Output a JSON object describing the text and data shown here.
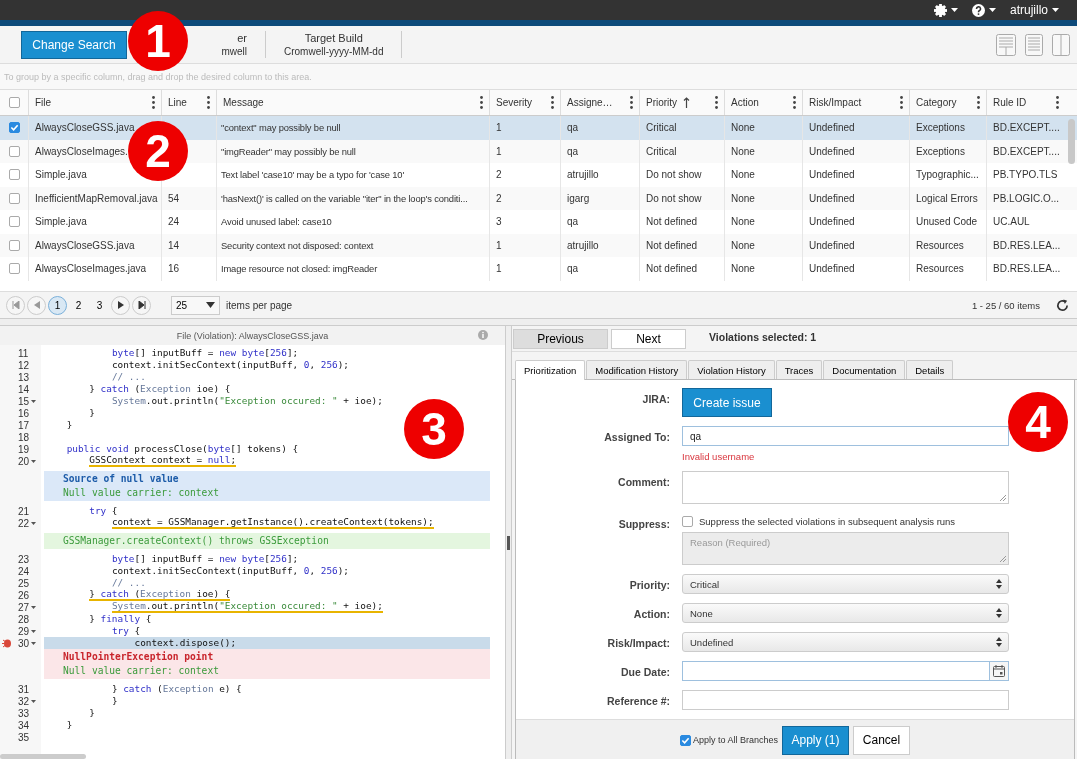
{
  "topbar": {
    "user": "atrujillo"
  },
  "toolbar": {
    "change_search": "Change Search",
    "builds": [
      {
        "title": "er",
        "value": "mwell"
      },
      {
        "title": "Target Build",
        "value": "Cromwell-yyyy-MM-dd"
      }
    ]
  },
  "group_hint": "To group by a specific column, drag and drop the desired column to this area.",
  "table": {
    "select_all_checked": false,
    "columns": [
      {
        "label": "File",
        "sorted": false
      },
      {
        "label": "Line",
        "sorted": false
      },
      {
        "label": "Message",
        "sorted": false
      },
      {
        "label": "Severity",
        "sorted": false
      },
      {
        "label": "Assigne…",
        "sorted": false
      },
      {
        "label": "Priority",
        "sorted": true
      },
      {
        "label": "Action",
        "sorted": false
      },
      {
        "label": "Risk/Impact",
        "sorted": false
      },
      {
        "label": "Category",
        "sorted": false
      },
      {
        "label": "Rule ID",
        "sorted": false
      }
    ],
    "rows": [
      {
        "selected": true,
        "cells": [
          "AlwaysCloseGSS.java",
          null,
          "\"context\" may possibly be null",
          "1",
          "qa",
          "Critical",
          "None",
          "Undefined",
          "Exceptions",
          "BD.EXCEPT...."
        ]
      },
      {
        "selected": false,
        "cells": [
          "AlwaysCloseImages.",
          null,
          "\"imgReader\" may possibly be null",
          "1",
          "qa",
          "Critical",
          "None",
          "Undefined",
          "Exceptions",
          "BD.EXCEPT...."
        ]
      },
      {
        "selected": false,
        "cells": [
          "Simple.java",
          null,
          "Text label 'case10' may be a typo for 'case 10'",
          "2",
          "atrujillo",
          "Do not show",
          "None",
          "Undefined",
          "Typographic...",
          "PB.TYPO.TLS"
        ]
      },
      {
        "selected": false,
        "cells": [
          "InefficientMapRemoval.java",
          "54",
          "'hasNext()' is called on the variable \"iter\" in the loop's conditi...",
          "2",
          "igarg",
          "Do not show",
          "None",
          "Undefined",
          "Logical Errors",
          "PB.LOGIC.O..."
        ]
      },
      {
        "selected": false,
        "cells": [
          "Simple.java",
          "24",
          "Avoid unused label: case10",
          "3",
          "qa",
          "Not defined",
          "None",
          "Undefined",
          "Unused Code",
          "UC.AUL"
        ]
      },
      {
        "selected": false,
        "cells": [
          "AlwaysCloseGSS.java",
          "14",
          "Security context not disposed: context",
          "1",
          "atrujillo",
          "Not defined",
          "None",
          "Undefined",
          "Resources",
          "BD.RES.LEA..."
        ]
      },
      {
        "selected": false,
        "cells": [
          "AlwaysCloseImages.java",
          "16",
          "Image resource not closed: imgReader",
          "1",
          "qa",
          "Not defined",
          "None",
          "Undefined",
          "Resources",
          "BD.RES.LEA..."
        ]
      }
    ]
  },
  "pager": {
    "pages": [
      {
        "label": "1",
        "selected": true
      },
      {
        "label": "2",
        "selected": false
      },
      {
        "label": "3",
        "selected": false
      }
    ],
    "page_size": "25",
    "page_size_label": "items per page",
    "summary": "1 - 25 / 60 items"
  },
  "code_view": {
    "title": "File (Violation): AlwaysCloseGSS.java",
    "items": [
      {
        "kind": "block",
        "children": [
          {
            "kind": "block",
            "children": [
              {
                "kind": "block",
                "children": [
                  {
                    "kind": "line",
                    "number": "11",
                    "fold": false,
                    "underline": false,
                    "highlight": false,
                    "flag": false,
                    "segments": [
                      {
                        "kind": "kw",
                        "text": "byte"
                      },
                      {
                        "kind": "plain",
                        "text": "[] inputBuff = "
                      },
                      {
                        "kind": "kw",
                        "text": "new byte"
                      },
                      {
                        "kind": "plain",
                        "text": "["
                      },
                      {
                        "kind": "num",
                        "text": "256"
                      },
                      {
                        "kind": "plain",
                        "text": "];"
                      }
                    ]
                  },
                  {
                    "kind": "line",
                    "number": "12",
                    "fold": false,
                    "underline": false,
                    "highlight": false,
                    "flag": false,
                    "segments": [
                      {
                        "kind": "plain",
                        "text": "context.initSecContext(inputBuff, "
                      },
                      {
                        "kind": "num",
                        "text": "0"
                      },
                      {
                        "kind": "plain",
                        "text": ", "
                      },
                      {
                        "kind": "num",
                        "text": "256"
                      },
                      {
                        "kind": "plain",
                        "text": ");"
                      }
                    ]
                  },
                  {
                    "kind": "line",
                    "number": "13",
                    "fold": false,
                    "underline": false,
                    "highlight": false,
                    "flag": false,
                    "segments": [
                      {
                        "kind": "comment",
                        "text": "// ..."
                      }
                    ]
                  }
                ]
              },
              {
                "kind": "line",
                "number": "14",
                "fold": false,
                "underline": false,
                "highlight": false,
                "flag": false,
                "segments": [
                  {
                    "kind": "plain",
                    "text": "} "
                  },
                  {
                    "kind": "kw",
                    "text": "catch"
                  },
                  {
                    "kind": "plain",
                    "text": " ("
                  },
                  {
                    "kind": "type",
                    "text": "Exception"
                  },
                  {
                    "kind": "plain",
                    "text": " ioe) {"
                  }
                ]
              },
              {
                "kind": "block",
                "children": [
                  {
                    "kind": "line",
                    "number": "15",
                    "fold": true,
                    "underline": false,
                    "highlight": false,
                    "flag": false,
                    "segments": [
                      {
                        "kind": "type",
                        "text": "System"
                      },
                      {
                        "kind": "plain",
                        "text": ".out.println("
                      },
                      {
                        "kind": "str",
                        "text": "\"Exception occured: \""
                      },
                      {
                        "kind": "plain",
                        "text": " + ioe);"
                      }
                    ]
                  }
                ]
              },
              {
                "kind": "line",
                "number": "16",
                "fold": false,
                "underline": false,
                "highlight": false,
                "flag": false,
                "segments": [
                  {
                    "kind": "plain",
                    "text": "}"
                  }
                ]
              }
            ]
          },
          {
            "kind": "line",
            "number": "17",
            "fold": false,
            "underline": false,
            "highlight": false,
            "flag": false,
            "segments": [
              {
                "kind": "plain",
                "text": "}"
              }
            ]
          },
          {
            "kind": "line",
            "number": "18",
            "fold": false,
            "highlight": false,
            "flag": false
          },
          {
            "kind": "line",
            "number": "19",
            "fold": false,
            "underline": false,
            "highlight": false,
            "flag": false,
            "segments": [
              {
                "kind": "kw",
                "text": "public void"
              },
              {
                "kind": "plain",
                "text": " processClose("
              },
              {
                "kind": "kw",
                "text": "byte"
              },
              {
                "kind": "plain",
                "text": "[] tokens) {"
              }
            ]
          },
          {
            "kind": "block",
            "children": [
              {
                "kind": "line",
                "number": "20",
                "fold": true,
                "underline": true,
                "highlight": false,
                "flag": false,
                "segments": [
                  {
                    "kind": "plain",
                    "text": "GSSContext context = "
                  },
                  {
                    "kind": "kw",
                    "text": "null"
                  },
                  {
                    "kind": "plain",
                    "text": ";"
                  }
                ]
              },
              {
                "kind": "source",
                "lines": [
                  {
                    "kind": "title",
                    "text": "Source of null value"
                  },
                  {
                    "kind": "detail",
                    "text": "Null value carrier: context"
                  }
                ]
              },
              {
                "kind": "line",
                "number": "21",
                "fold": false,
                "underline": false,
                "highlight": false,
                "flag": false,
                "segments": [
                  {
                    "kind": "kw",
                    "text": "try"
                  },
                  {
                    "kind": "plain",
                    "text": " {"
                  }
                ]
              },
              {
                "kind": "block",
                "children": [
                  {
                    "kind": "line",
                    "number": "22",
                    "fold": true,
                    "underline": true,
                    "highlight": false,
                    "flag": false,
                    "segments": [
                      {
                        "kind": "plain",
                        "text": "context = GSSManager.getInstance().createContext(tokens);"
                      }
                    ]
                  },
                  {
                    "kind": "throws",
                    "lines": [
                      {
                        "kind": "detail",
                        "text": "GSSManager.createContext() throws GSSException"
                      }
                    ]
                  },
                  {
                    "kind": "line",
                    "number": "23",
                    "fold": false,
                    "underline": false,
                    "highlight": false,
                    "flag": false,
                    "segments": [
                      {
                        "kind": "kw",
                        "text": "byte"
                      },
                      {
                        "kind": "plain",
                        "text": "[] inputBuff = "
                      },
                      {
                        "kind": "kw",
                        "text": "new byte"
                      },
                      {
                        "kind": "plain",
                        "text": "["
                      },
                      {
                        "kind": "num",
                        "text": "256"
                      },
                      {
                        "kind": "plain",
                        "text": "];"
                      }
                    ]
                  },
                  {
                    "kind": "line",
                    "number": "24",
                    "fold": false,
                    "underline": false,
                    "highlight": false,
                    "flag": false,
                    "segments": [
                      {
                        "kind": "plain",
                        "text": "context.initSecContext(inputBuff, "
                      },
                      {
                        "kind": "num",
                        "text": "0"
                      },
                      {
                        "kind": "plain",
                        "text": ", "
                      },
                      {
                        "kind": "num",
                        "text": "256"
                      },
                      {
                        "kind": "plain",
                        "text": ");"
                      }
                    ]
                  },
                  {
                    "kind": "line",
                    "number": "25",
                    "fold": false,
                    "underline": false,
                    "highlight": false,
                    "flag": false,
                    "segments": [
                      {
                        "kind": "comment",
                        "text": "// ..."
                      }
                    ]
                  }
                ]
              },
              {
                "kind": "line",
                "number": "26",
                "fold": false,
                "underline": true,
                "highlight": false,
                "flag": false,
                "segments": [
                  {
                    "kind": "plain",
                    "text": "} "
                  },
                  {
                    "kind": "kw",
                    "text": "catch"
                  },
                  {
                    "kind": "plain",
                    "text": " ("
                  },
                  {
                    "kind": "type",
                    "text": "Exception"
                  },
                  {
                    "kind": "plain",
                    "text": " ioe) {"
                  }
                ]
              },
              {
                "kind": "block",
                "children": [
                  {
                    "kind": "line",
                    "number": "27",
                    "fold": true,
                    "underline": true,
                    "highlight": false,
                    "flag": false,
                    "segments": [
                      {
                        "kind": "type",
                        "text": "System"
                      },
                      {
                        "kind": "plain",
                        "text": ".out.println("
                      },
                      {
                        "kind": "str",
                        "text": "\"Exception occured: \""
                      },
                      {
                        "kind": "plain",
                        "text": " + ioe);"
                      }
                    ]
                  }
                ]
              },
              {
                "kind": "line",
                "number": "28",
                "fold": false,
                "underline": false,
                "highlight": false,
                "flag": false,
                "segments": [
                  {
                    "kind": "plain",
                    "text": "} "
                  },
                  {
                    "kind": "kw",
                    "text": "finally"
                  },
                  {
                    "kind": "plain",
                    "text": " {"
                  }
                ]
              },
              {
                "kind": "block",
                "children": [
                  {
                    "kind": "line",
                    "number": "29",
                    "fold": true,
                    "underline": false,
                    "highlight": false,
                    "flag": false,
                    "segments": [
                      {
                        "kind": "kw",
                        "text": "try"
                      },
                      {
                        "kind": "plain",
                        "text": " {"
                      }
                    ]
                  },
                  {
                    "kind": "block",
                    "children": [
                      {
                        "kind": "line",
                        "number": "30",
                        "fold": true,
                        "underline": false,
                        "highlight": true,
                        "flag": true,
                        "segments": [
                          {
                            "kind": "plain",
                            "text": "context.dispose();"
                          }
                        ]
                      },
                      {
                        "kind": "crash",
                        "lines": [
                          {
                            "kind": "title",
                            "text": "NullPointerException point"
                          },
                          {
                            "kind": "detail",
                            "text": "Null value carrier: context"
                          }
                        ]
                      }
                    ]
                  },
                  {
                    "kind": "line",
                    "number": "31",
                    "fold": false,
                    "underline": false,
                    "highlight": false,
                    "flag": false,
                    "segments": [
                      {
                        "kind": "plain",
                        "text": "} "
                      },
                      {
                        "kind": "kw",
                        "text": "catch"
                      },
                      {
                        "kind": "plain",
                        "text": " ("
                      },
                      {
                        "kind": "type",
                        "text": "Exception"
                      },
                      {
                        "kind": "plain",
                        "text": " e) {"
                      }
                    ]
                  },
                  {
                    "kind": "line",
                    "number": "32",
                    "fold": true,
                    "underline": false,
                    "highlight": false,
                    "flag": false,
                    "segments": [
                      {
                        "kind": "plain",
                        "text": "}"
                      }
                    ]
                  }
                ]
              },
              {
                "kind": "line",
                "number": "33",
                "fold": false,
                "underline": false,
                "highlight": false,
                "flag": false,
                "segments": [
                  {
                    "kind": "plain",
                    "text": "}"
                  }
                ]
              }
            ]
          },
          {
            "kind": "line",
            "number": "34",
            "fold": false,
            "underline": false,
            "highlight": false,
            "flag": false,
            "segments": [
              {
                "kind": "plain",
                "text": "}"
              }
            ]
          },
          {
            "kind": "line",
            "number": "35",
            "fold": false,
            "highlight": false,
            "flag": false
          }
        ]
      }
    ]
  },
  "details": {
    "nav": [
      {
        "label": "Previous",
        "selected": true
      },
      {
        "label": "Next",
        "selected": false
      }
    ],
    "selection_count": "Violations selected: 1",
    "tabs": [
      {
        "label": "Prioritization",
        "selected": true
      },
      {
        "label": "Modification History",
        "selected": false
      },
      {
        "label": "Violation History",
        "selected": false
      },
      {
        "label": "Traces",
        "selected": false
      },
      {
        "label": "Documentation",
        "selected": false
      },
      {
        "label": "Details",
        "selected": false
      }
    ],
    "fields": [
      {
        "kind": "button",
        "label": "JIRA:",
        "button": "Create issue"
      },
      {
        "kind": "text",
        "label": "Assigned To:",
        "value": "qa",
        "error": "Invalid username"
      },
      {
        "kind": "textarea",
        "label": "Comment:"
      },
      {
        "kind": "suppress",
        "label": "Suppress:",
        "checked": false,
        "option": "Suppress the selected violations in subsequent analysis runs",
        "placeholder": "Reason (Required)"
      },
      {
        "kind": "select",
        "label": "Priority:",
        "value": "Critical"
      },
      {
        "kind": "select",
        "label": "Action:",
        "value": "None"
      },
      {
        "kind": "select",
        "label": "Risk/Impact:",
        "value": "Undefined"
      },
      {
        "kind": "date",
        "label": "Due Date:"
      },
      {
        "kind": "text",
        "label": "Reference #:"
      }
    ],
    "apply_all": {
      "label": "Apply to All Branches",
      "checked": true
    },
    "apply": "Apply (1)",
    "cancel": "Cancel"
  },
  "callouts": [
    {
      "label": "1"
    },
    {
      "label": "2"
    },
    {
      "label": "3"
    },
    {
      "label": "4"
    }
  ]
}
